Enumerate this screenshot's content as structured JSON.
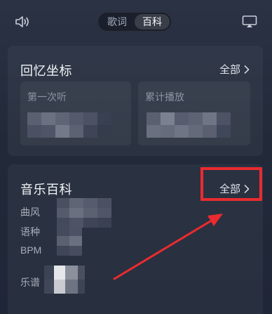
{
  "topbar": {
    "volume_icon": "speaker-icon",
    "cast_icon": "airplay-icon",
    "tabs": [
      {
        "label": "歌词",
        "active": false
      },
      {
        "label": "百科",
        "active": true
      }
    ]
  },
  "memory": {
    "title": "回忆坐标",
    "all_label": "全部",
    "tiles": [
      {
        "label": "第一次听"
      },
      {
        "label": "累计播放"
      }
    ]
  },
  "wiki": {
    "title": "音乐百科",
    "all_label": "全部",
    "rows": [
      {
        "label": "曲风"
      },
      {
        "label": "语种"
      },
      {
        "label": "BPM"
      },
      {
        "label": "乐谱"
      }
    ]
  },
  "annotation": {
    "highlight_color": "#ea2b2f"
  },
  "colors": {
    "background": "#222a3b",
    "card": "#2c3446",
    "accent_red": "#ea2b2f"
  }
}
